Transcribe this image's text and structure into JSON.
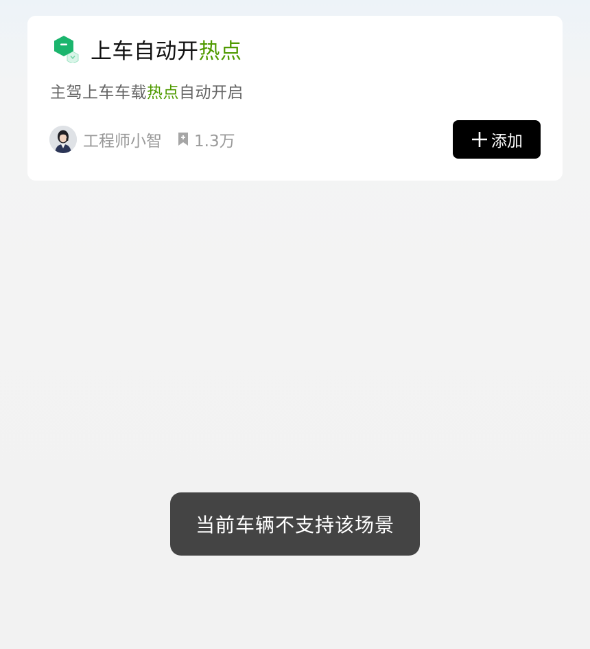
{
  "scene_card": {
    "icon": "green-hexagon-scene-icon",
    "title_main": "上车自动开",
    "title_highlight": "热点",
    "description_before": "主驾上车车载",
    "description_highlight": "热点",
    "description_after": "自动开启",
    "author_avatar": "engineer-avatar",
    "author_name": "工程师小智",
    "bookmark_icon": "bookmark-icon",
    "bookmark_count": "1.3万",
    "add_icon": "plus-icon",
    "add_label": "添加"
  },
  "toast": {
    "message": "当前车辆不支持该场景"
  },
  "colors": {
    "highlight_green": "#4f9a00",
    "icon_green": "#1bb56d",
    "button_black": "#000000",
    "toast_bg": "#444444"
  }
}
